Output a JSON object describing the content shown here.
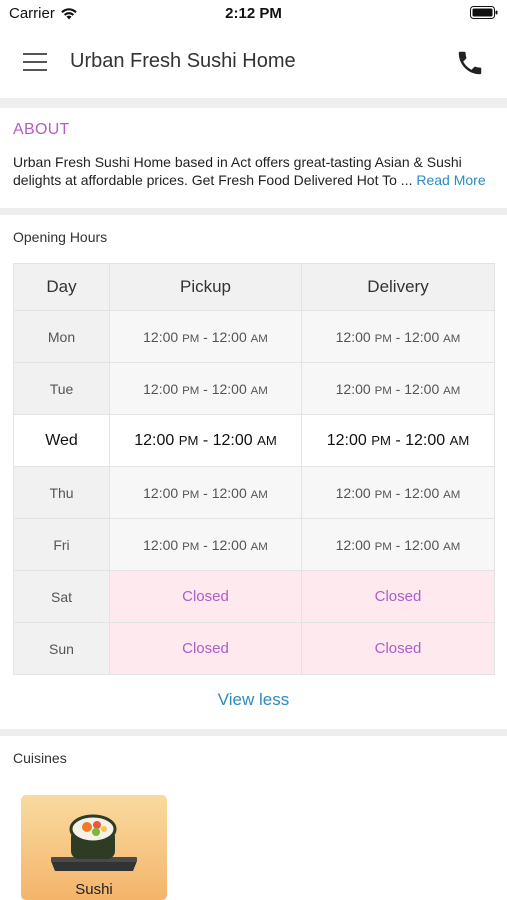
{
  "status_bar": {
    "carrier": "Carrier",
    "time": "2:12 PM"
  },
  "header": {
    "title": "Urban Fresh Sushi Home",
    "menu_icon": "hamburger-icon",
    "phone_icon": "phone-icon"
  },
  "about": {
    "heading": "ABOUT",
    "text": "Urban Fresh Sushi Home based in Act offers great-tasting Asian & Sushi delights at affordable prices. Get Fresh Food Delivered Hot To ...",
    "read_more": "Read More"
  },
  "opening_hours": {
    "title": "Opening Hours",
    "headers": {
      "day": "Day",
      "pickup": "Pickup",
      "delivery": "Delivery"
    },
    "rows": [
      {
        "day": "Mon",
        "pickup": {
          "start": "12:00",
          "start_suffix": "PM",
          "end": "12:00",
          "end_suffix": "AM"
        },
        "delivery": {
          "start": "12:00",
          "start_suffix": "PM",
          "end": "12:00",
          "end_suffix": "AM"
        }
      },
      {
        "day": "Tue",
        "pickup": {
          "start": "12:00",
          "start_suffix": "PM",
          "end": "12:00",
          "end_suffix": "AM"
        },
        "delivery": {
          "start": "12:00",
          "start_suffix": "PM",
          "end": "12:00",
          "end_suffix": "AM"
        }
      },
      {
        "day": "Wed",
        "pickup": {
          "start": "12:00",
          "start_suffix": "PM",
          "end": "12:00",
          "end_suffix": "AM"
        },
        "delivery": {
          "start": "12:00",
          "start_suffix": "PM",
          "end": "12:00",
          "end_suffix": "AM"
        }
      },
      {
        "day": "Thu",
        "pickup": {
          "start": "12:00",
          "start_suffix": "PM",
          "end": "12:00",
          "end_suffix": "AM"
        },
        "delivery": {
          "start": "12:00",
          "start_suffix": "PM",
          "end": "12:00",
          "end_suffix": "AM"
        }
      },
      {
        "day": "Fri",
        "pickup": {
          "start": "12:00",
          "start_suffix": "PM",
          "end": "12:00",
          "end_suffix": "AM"
        },
        "delivery": {
          "start": "12:00",
          "start_suffix": "PM",
          "end": "12:00",
          "end_suffix": "AM"
        }
      },
      {
        "day": "Sat",
        "pickup": {
          "closed": "Closed"
        },
        "delivery": {
          "closed": "Closed"
        }
      },
      {
        "day": "Sun",
        "pickup": {
          "closed": "Closed"
        },
        "delivery": {
          "closed": "Closed"
        }
      }
    ],
    "separator": " - ",
    "view_less": "View less"
  },
  "cuisines": {
    "title": "Cuisines",
    "items": [
      {
        "label": "Sushi",
        "icon": "sushi-icon"
      }
    ]
  },
  "colors": {
    "accent_purple": "#b65cc9",
    "link_blue": "#2b8bbf",
    "closed_bg": "#fde9ee"
  }
}
